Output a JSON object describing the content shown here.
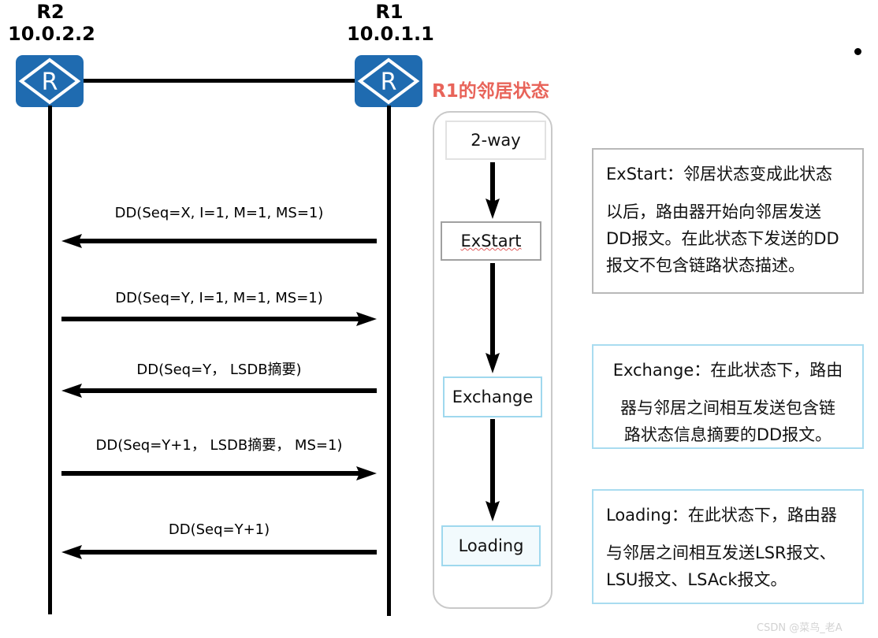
{
  "topology": {
    "left_router": {
      "name": "R2",
      "ip": "10.0.2.2",
      "icon": "router-icon",
      "glyph": "R"
    },
    "right_router": {
      "name": "R1",
      "ip": "10.0.1.1",
      "icon": "router-icon",
      "glyph": "R"
    }
  },
  "sequence": {
    "messages": [
      {
        "label": "DD(Seq=X, I=1, M=1, MS=1)",
        "direction": "right-to-left",
        "spell_error": "Seq"
      },
      {
        "label": "DD(Seq=Y, I=1, M=1, MS=1)",
        "direction": "left-to-right",
        "spell_error": ""
      },
      {
        "label": "DD(Seq=Y， LSDB摘要)",
        "direction": "right-to-left",
        "spell_error": "Seq"
      },
      {
        "label": "DD(Seq=Y+1， LSDB摘要， MS=1)",
        "direction": "left-to-right",
        "spell_error": ""
      },
      {
        "label": "DD(Seq=Y+1)",
        "direction": "right-to-left",
        "spell_error": ""
      }
    ]
  },
  "state_machine": {
    "title": "R1的邻居状态",
    "title_color": "#E8645A",
    "states": [
      {
        "label": "2-way",
        "style": "grey-light"
      },
      {
        "label": "ExStart",
        "style": "grey-mid"
      },
      {
        "label": "Exchange",
        "style": "blue-line"
      },
      {
        "label": "Loading",
        "style": "blue-fill"
      }
    ]
  },
  "callouts": [
    {
      "id": "exstart-callout",
      "style": "grey",
      "align": "left",
      "lines": [
        "ExStart：邻居状态变成此状态",
        "以后，路由器开始向邻居发送",
        "DD报文。在此状态下发送的DD",
        "报文不包含链路状态描述。"
      ]
    },
    {
      "id": "exchange-callout",
      "style": "blue",
      "align": "center",
      "lines": [
        "Exchange：在此状态下，路由",
        "器与邻居之间相互发送包含链",
        "路状态信息摘要的DD报文。"
      ]
    },
    {
      "id": "loading-callout",
      "style": "blue",
      "align": "left",
      "lines": [
        "Loading：在此状态下，路由器",
        "与邻居之间相互发送LSR报文、",
        "LSU报文、LSAck报文。"
      ]
    }
  ],
  "watermark": {
    "text": "CSDN @菜鸟_老A"
  },
  "colors": {
    "router_blue": "#1F6BB0",
    "accent_red": "#E8645A",
    "accent_blue": "#9FD8EE",
    "line_black": "#000000"
  }
}
